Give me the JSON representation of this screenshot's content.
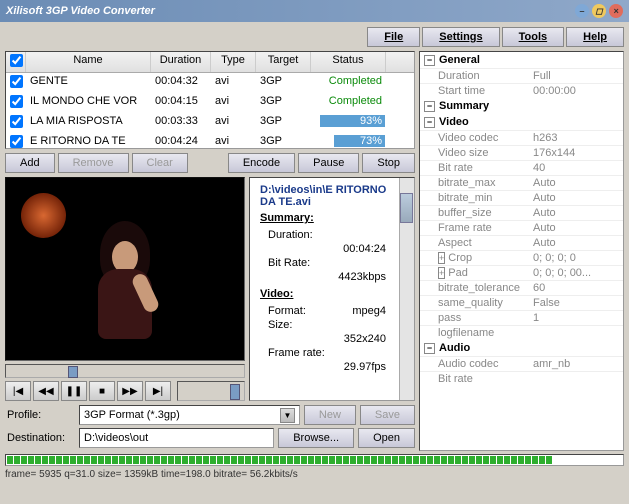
{
  "title": "Xilisoft 3GP Video Converter",
  "menu": {
    "file": "File",
    "settings": "Settings",
    "tools": "Tools",
    "help": "Help"
  },
  "columns": {
    "name": "Name",
    "duration": "Duration",
    "type": "Type",
    "target": "Target",
    "status": "Status"
  },
  "files": [
    {
      "name": "GENTE",
      "duration": "00:04:32",
      "type": "avi",
      "target": "3GP",
      "status": "Completed",
      "kind": "done"
    },
    {
      "name": "IL MONDO CHE VOR",
      "duration": "00:04:15",
      "type": "avi",
      "target": "3GP",
      "status": "Completed",
      "kind": "done"
    },
    {
      "name": "LA MIA RISPOSTA",
      "duration": "00:03:33",
      "type": "avi",
      "target": "3GP",
      "status": "93%",
      "kind": "prog",
      "pct": 93
    },
    {
      "name": "E RITORNO DA TE",
      "duration": "00:04:24",
      "type": "avi",
      "target": "3GP",
      "status": "73%",
      "kind": "prog",
      "pct": 73
    }
  ],
  "buttons": {
    "add": "Add",
    "remove": "Remove",
    "clear": "Clear",
    "encode": "Encode",
    "pause": "Pause",
    "stop": "Stop",
    "new": "New",
    "save": "Save",
    "browse": "Browse...",
    "open": "Open"
  },
  "info": {
    "path": "D:\\videos\\in\\E RITORNO DA TE.avi",
    "summary_label": "Summary:",
    "duration_label": "Duration:",
    "duration": "00:04:24",
    "bitrate_label": "Bit Rate:",
    "bitrate": "4423kbps",
    "video_label": "Video:",
    "format_label": "Format:",
    "format": "mpeg4",
    "size_label": "Size:",
    "size": "352x240",
    "framerate_label": "Frame rate:",
    "framerate": "29.97fps"
  },
  "props": {
    "sections": {
      "general": "General",
      "summary": "Summary",
      "video": "Video",
      "audio": "Audio"
    },
    "general": [
      {
        "k": "Duration",
        "v": "Full"
      },
      {
        "k": "Start time",
        "v": "00:00:00"
      }
    ],
    "video": [
      {
        "k": "Video codec",
        "v": "h263"
      },
      {
        "k": "Video size",
        "v": "176x144"
      },
      {
        "k": "Bit rate",
        "v": "40"
      },
      {
        "k": "bitrate_max",
        "v": "Auto"
      },
      {
        "k": "bitrate_min",
        "v": "Auto"
      },
      {
        "k": "buffer_size",
        "v": "Auto"
      },
      {
        "k": "Frame rate",
        "v": "Auto"
      },
      {
        "k": "Aspect",
        "v": "Auto"
      },
      {
        "k": "Crop",
        "v": "0; 0; 0; 0",
        "exp": true
      },
      {
        "k": "Pad",
        "v": "0; 0; 0; 00...",
        "exp": true
      },
      {
        "k": "bitrate_tolerance",
        "v": "60"
      },
      {
        "k": "same_quality",
        "v": "False"
      },
      {
        "k": "pass",
        "v": "1"
      },
      {
        "k": "logfilename",
        "v": ""
      }
    ],
    "audio": [
      {
        "k": "Audio codec",
        "v": "amr_nb"
      },
      {
        "k": "Bit rate",
        "v": ""
      }
    ]
  },
  "profile": {
    "label": "Profile:",
    "value": "3GP Format  (*.3gp)"
  },
  "destination": {
    "label": "Destination:",
    "value": "D:\\videos\\out"
  },
  "statusline": "frame= 5935 q=31.0 size=    1359kB time=198.0 bitrate=  56.2kbits/s"
}
